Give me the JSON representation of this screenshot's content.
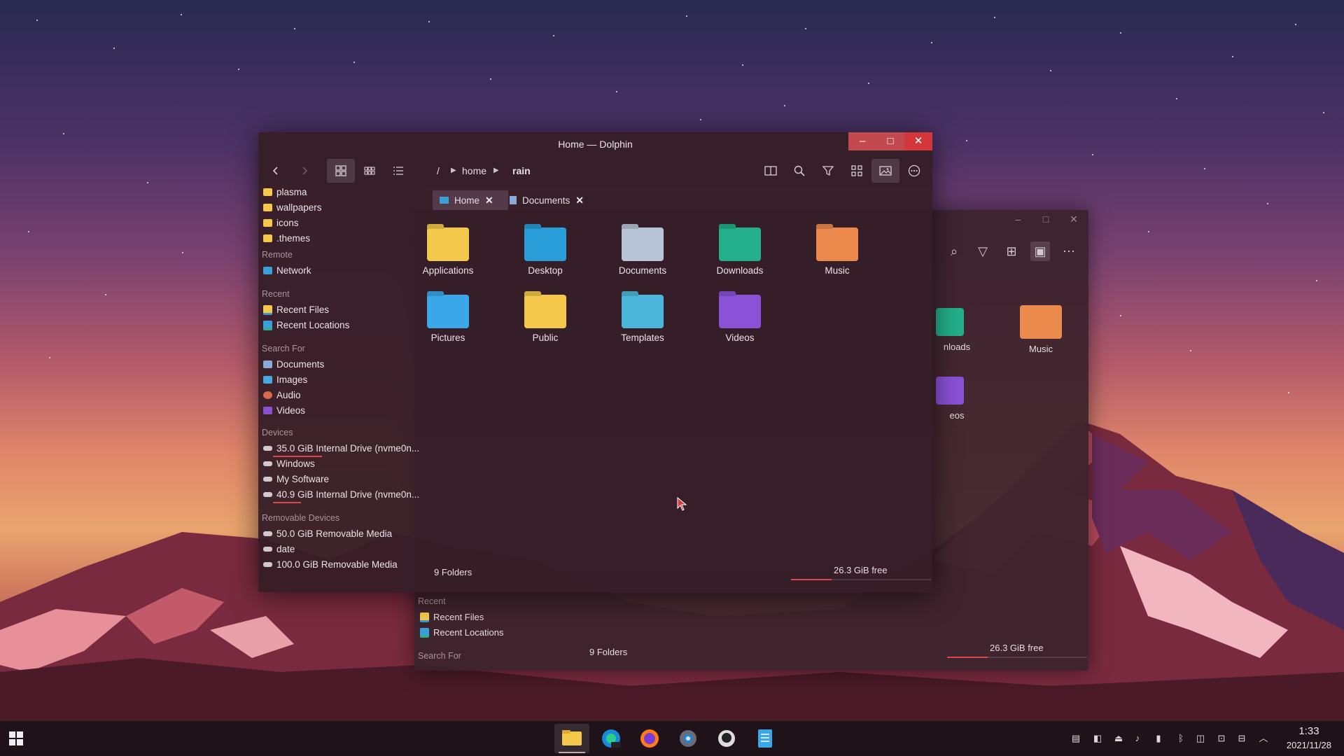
{
  "window": {
    "title": "Home — Dolphin",
    "controls": {
      "minimize": "–",
      "maximize": "□",
      "close": "✕"
    }
  },
  "breadcrumb": [
    {
      "label": "/"
    },
    {
      "label": "home"
    },
    {
      "label": "rain"
    }
  ],
  "tabs": [
    {
      "label": "Home",
      "active": true
    },
    {
      "label": "Documents",
      "active": false
    }
  ],
  "sidebar": {
    "places": [
      "plasma",
      "wallpapers",
      "icons",
      ".themes"
    ],
    "sections": {
      "remote": "Remote",
      "recent": "Recent",
      "search_for": "Search For",
      "devices": "Devices",
      "removable": "Removable Devices"
    },
    "remote_items": [
      "Network"
    ],
    "recent_items": [
      "Recent Files",
      "Recent Locations"
    ],
    "search_items": [
      "Documents",
      "Images",
      "Audio",
      "Videos"
    ],
    "device_items": [
      "35.0 GiB Internal Drive (nvme0n...",
      "Windows",
      "My Software",
      "40.9 GiB Internal Drive (nvme0n..."
    ],
    "removable_items": [
      "50.0 GiB Removable Media",
      "date",
      "100.0 GiB Removable Media"
    ]
  },
  "folders": [
    {
      "label": "Applications",
      "icon": "applications-folder-icon",
      "color": "#f4c84a"
    },
    {
      "label": "Desktop",
      "icon": "desktop-folder-icon",
      "color": "#2a9ed8"
    },
    {
      "label": "Documents",
      "icon": "documents-folder-icon",
      "color": "#b7c4d6"
    },
    {
      "label": "Downloads",
      "icon": "downloads-folder-icon",
      "color": "#23b08a"
    },
    {
      "label": "Music",
      "icon": "music-folder-icon",
      "color": "#ec8a4e"
    },
    {
      "label": "Pictures",
      "icon": "pictures-folder-icon",
      "color": "#3aa8e8"
    },
    {
      "label": "Public",
      "icon": "public-folder-icon",
      "color": "#f4c84a"
    },
    {
      "label": "Templates",
      "icon": "templates-folder-icon",
      "color": "#4cb6da"
    },
    {
      "label": "Videos",
      "icon": "videos-folder-icon",
      "color": "#8a52d6"
    }
  ],
  "status": {
    "folders_count": "9 Folders",
    "free_space": "26.3 GiB free",
    "disk_used_fraction": 0.29
  },
  "back_window": {
    "items": [
      "nloads",
      "Music",
      "eos"
    ],
    "sidebar_recent": "Recent",
    "recent_items": [
      "Recent Files",
      "Recent Locations"
    ],
    "search_for": "Search For",
    "folders_count": "9 Folders",
    "free_space": "26.3 GiB free"
  },
  "taskbar": {
    "apps": [
      "dolphin-file-manager-icon",
      "edge-dev-icon",
      "firefox-icon",
      "settings-icon",
      "github-icon",
      "notes-icon"
    ],
    "clock_time": "1:33",
    "clock_date": "2021/11/28"
  },
  "colors": {
    "accent": "#d8484e",
    "window_bg": "#361e28",
    "close_button": "#d3373a"
  }
}
